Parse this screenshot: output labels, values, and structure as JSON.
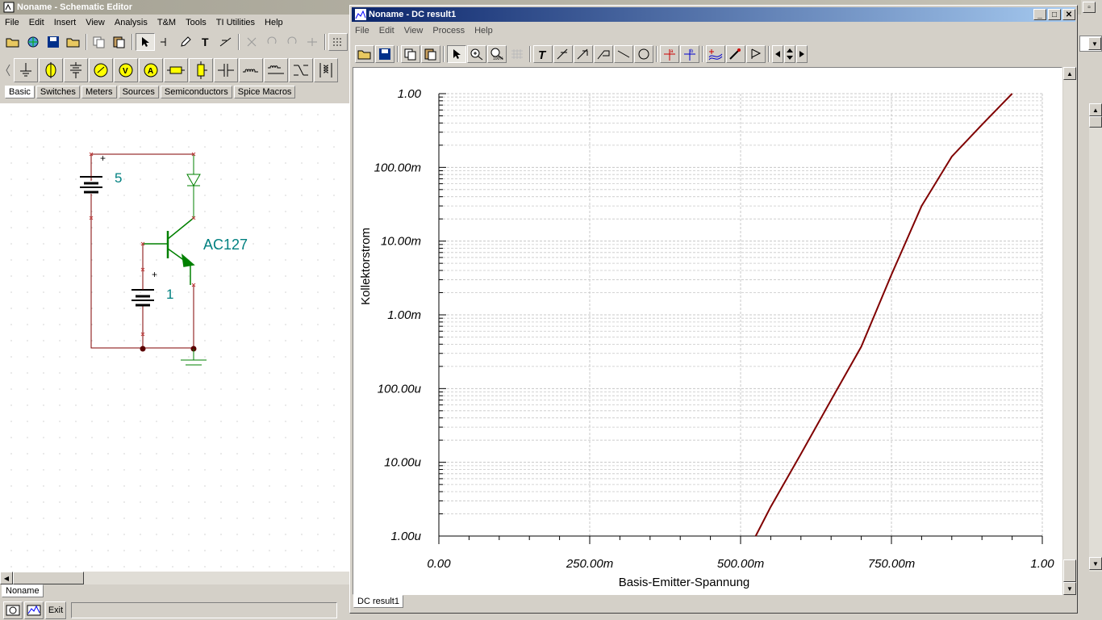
{
  "schematic": {
    "title": "Noname - Schematic Editor",
    "menu": [
      "File",
      "Edit",
      "Insert",
      "View",
      "Analysis",
      "T&M",
      "Tools",
      "TI Utilities",
      "Help"
    ],
    "tabs": [
      "Basic",
      "Switches",
      "Meters",
      "Sources",
      "Semiconductors",
      "Spice Macros"
    ],
    "selected_tab": "Basic",
    "circuit": {
      "battery1_value": "5",
      "battery2_value": "1",
      "transistor_label": "AC127",
      "plus_sign": "+"
    },
    "doc_tab": "Noname",
    "exit_label": "Exit"
  },
  "result": {
    "title": "Noname - DC result1",
    "menu": [
      "File",
      "Edit",
      "View",
      "Process",
      "Help"
    ],
    "bottom_tab": "DC result1",
    "colors": {
      "curve": "#800000",
      "grid": "#c8c8c8",
      "text": "#000000"
    }
  },
  "chart_data": {
    "type": "line",
    "title": "",
    "xlabel": "Basis-Emitter-Spannung",
    "ylabel": "Kollektorstrom",
    "xlim": [
      0,
      1.0
    ],
    "ylim": [
      1e-06,
      1.0
    ],
    "yscale": "log",
    "grid": true,
    "legend": "none",
    "x_ticks": [
      "0.00",
      "250.00m",
      "500.00m",
      "750.00m",
      "1.00"
    ],
    "y_ticks": [
      "1.00u",
      "10.00u",
      "100.00u",
      "1.00m",
      "10.00m",
      "100.00m",
      "1.00"
    ],
    "series": [
      {
        "x": [
          0.525,
          0.55,
          0.6,
          0.65,
          0.7,
          0.75,
          0.8,
          0.85,
          0.9,
          0.95
        ],
        "y": [
          1e-06,
          2.5e-06,
          1.3e-05,
          7e-05,
          0.00037,
          0.0035,
          0.03,
          0.14,
          0.38,
          1.0
        ]
      }
    ]
  }
}
